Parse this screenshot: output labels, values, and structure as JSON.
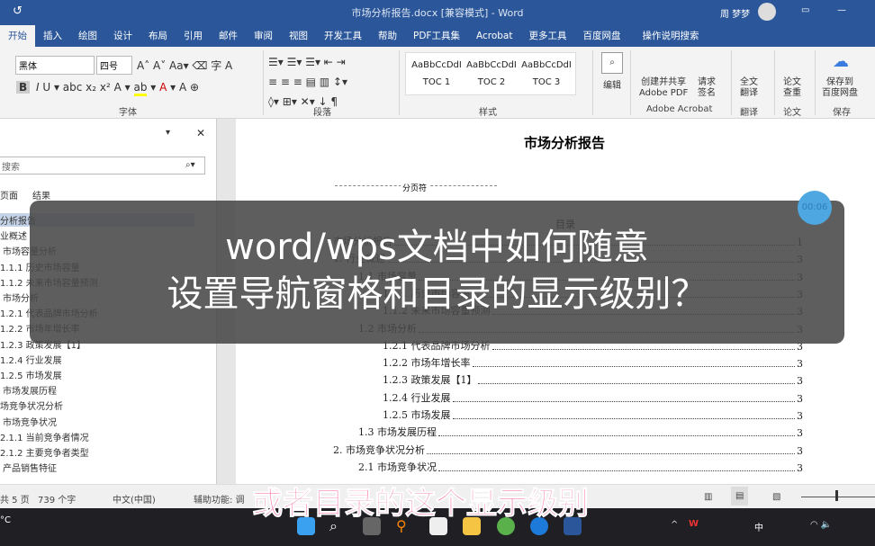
{
  "window": {
    "title": "市场分析报告.docx [兼容模式] - Word",
    "user": "周 梦梦"
  },
  "tabs": [
    "开始",
    "插入",
    "绘图",
    "设计",
    "布局",
    "引用",
    "邮件",
    "审阅",
    "视图",
    "开发工具",
    "帮助",
    "PDF工具集",
    "Acrobat",
    "更多工具",
    "百度网盘",
    "操作说明搜索"
  ],
  "ribbon": {
    "font_name": "黑体",
    "font_size": "四号",
    "groups": {
      "font": "字体",
      "paragraph": "段落",
      "styles": "样式",
      "adobe": "Adobe Acrobat",
      "translate": "翻译",
      "paper": "论文",
      "save": "保存"
    },
    "styles": [
      {
        "sample": "AaBbCcDdI",
        "name": "TOC 1"
      },
      {
        "sample": "AaBbCcDdI",
        "name": "TOC 2"
      },
      {
        "sample": "AaBbCcDdI",
        "name": "TOC 3"
      }
    ],
    "buttons": {
      "edit": "编辑",
      "create_pdf": "创建并共享\nAdobe PDF",
      "sign": "请求\n签名",
      "translate": "全文\n翻译",
      "check": "论文\n查重",
      "baidu": "保存到\n百度网盘"
    }
  },
  "nav": {
    "search_placeholder": "搜索",
    "tabs": [
      "页面",
      "结果"
    ],
    "items": [
      "分析报告",
      "业概述",
      "市场容量分析",
      "1.1.1 历史市场容量",
      "1.1.2 未来市场容量预测",
      "市场分析",
      "1.2.1 代表品牌市场分析",
      "1.2.2 市场年增长率",
      "1.2.3 政策发展【1】",
      "1.2.4 行业发展",
      "1.2.5 市场发展",
      "市场发展历程",
      "场竞争状况分析",
      "市场竞争状况",
      "2.1.1 当前竞争者情况",
      "2.1.2 主要竞争者类型",
      "产品销售特征"
    ]
  },
  "document": {
    "title": "市场分析报告",
    "page_break": "分页符",
    "toc_title": "目录",
    "toc": [
      {
        "text": "市场分析报告",
        "page": "1",
        "level": 0
      },
      {
        "text": "1. 行业概述",
        "page": "3",
        "level": 0
      },
      {
        "text": "1.1 市场容量",
        "page": "3",
        "level": 1
      },
      {
        "text": "1.1.1 历史市场容量",
        "page": "3",
        "level": 2
      },
      {
        "text": "1.1.2 未来市场容量预测",
        "page": "3",
        "level": 2
      },
      {
        "text": "1.2 市场分析",
        "page": "3",
        "level": 1
      },
      {
        "text": "1.2.1 代表品牌市场分析",
        "page": "3",
        "level": 2
      },
      {
        "text": "1.2.2 市场年增长率",
        "page": "3",
        "level": 2
      },
      {
        "text": "1.2.3 政策发展【1】",
        "page": "3",
        "level": 2
      },
      {
        "text": "1.2.4 行业发展",
        "page": "3",
        "level": 2
      },
      {
        "text": "1.2.5 市场发展",
        "page": "3",
        "level": 2
      },
      {
        "text": "1.3 市场发展历程",
        "page": "3",
        "level": 1
      },
      {
        "text": "2. 市场竞争状况分析",
        "page": "3",
        "level": 0
      },
      {
        "text": "2.1 市场竞争状况",
        "page": "3",
        "level": 1
      }
    ]
  },
  "status": {
    "pages": "共 5 页",
    "words": "739 个字",
    "language": "中文(中国)",
    "accessibility": "辅助功能: 调"
  },
  "overlay": {
    "line1": "word/wps文档中如何随意",
    "line2": "设置导航窗格和目录的显示级别？",
    "subtitle": "或者目录的这个显示级别",
    "timer": "00:06"
  },
  "taskbar": {
    "weather": "°C",
    "ime": "中"
  }
}
